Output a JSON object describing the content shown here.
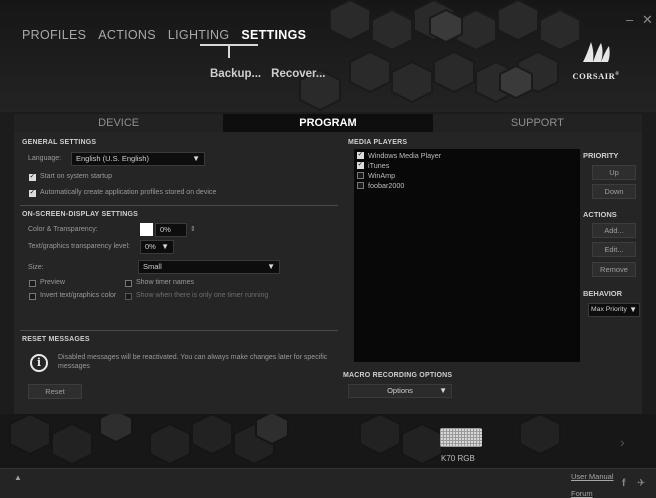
{
  "window": {
    "minimize": "–",
    "close": "✕"
  },
  "top_nav": {
    "tabs": [
      {
        "label": "PROFILES"
      },
      {
        "label": "ACTIONS"
      },
      {
        "label": "LIGHTING"
      },
      {
        "label": "SETTINGS",
        "active": true
      }
    ],
    "sub_actions": {
      "backup": "Backup...",
      "recover": "Recover..."
    }
  },
  "brand": {
    "name": "CORSAIR",
    "trademark": "®"
  },
  "section_tabs": [
    {
      "label": "DEVICE"
    },
    {
      "label": "PROGRAM",
      "active": true
    },
    {
      "label": "SUPPORT"
    }
  ],
  "general": {
    "title": "GENERAL SETTINGS",
    "language_label": "Language:",
    "language_value": "English (U.S. English)",
    "startup_label": "Start on system startup",
    "startup_checked": true,
    "autoprofile_label": "Automatically create application profiles stored on device",
    "autoprofile_checked": true
  },
  "osd": {
    "title": "ON-SCREEN-DISPLAY SETTINGS",
    "color_label": "Color & Transparency:",
    "color_value": "0%",
    "color_swatch": "#ffffff",
    "text_label": "Text/graphics transparency level:",
    "text_value": "0%",
    "size_label": "Size:",
    "size_value": "Small",
    "preview_label": "Preview",
    "timer_label": "Show timer names",
    "invert_label": "Invert text/graphics color",
    "single_label": "Show when there is only one timer running"
  },
  "reset": {
    "title": "RESET MESSAGES",
    "message": "Disabled messages will be reactivated. You can always make changes later for specific messages",
    "button": "Reset"
  },
  "media": {
    "title": "MEDIA PLAYERS",
    "players": [
      {
        "label": "Windows Media Player",
        "checked": true
      },
      {
        "label": "iTunes",
        "checked": true
      },
      {
        "label": "WinAmp",
        "checked": false
      },
      {
        "label": "foobar2000",
        "checked": false
      }
    ]
  },
  "macro": {
    "title": "MACRO RECORDING OPTIONS",
    "options_label": "Options"
  },
  "priority": {
    "title": "PRIORITY",
    "up": "Up",
    "down": "Down"
  },
  "actions": {
    "title": "ACTIONS",
    "add": "Add...",
    "edit": "Edit...",
    "remove": "Remove"
  },
  "behavior": {
    "title": "BEHAVIOR",
    "value": "Max Priority"
  },
  "device": {
    "name": "K70 RGB"
  },
  "footer": {
    "user_manual": "User Manual",
    "forum": "Forum"
  }
}
